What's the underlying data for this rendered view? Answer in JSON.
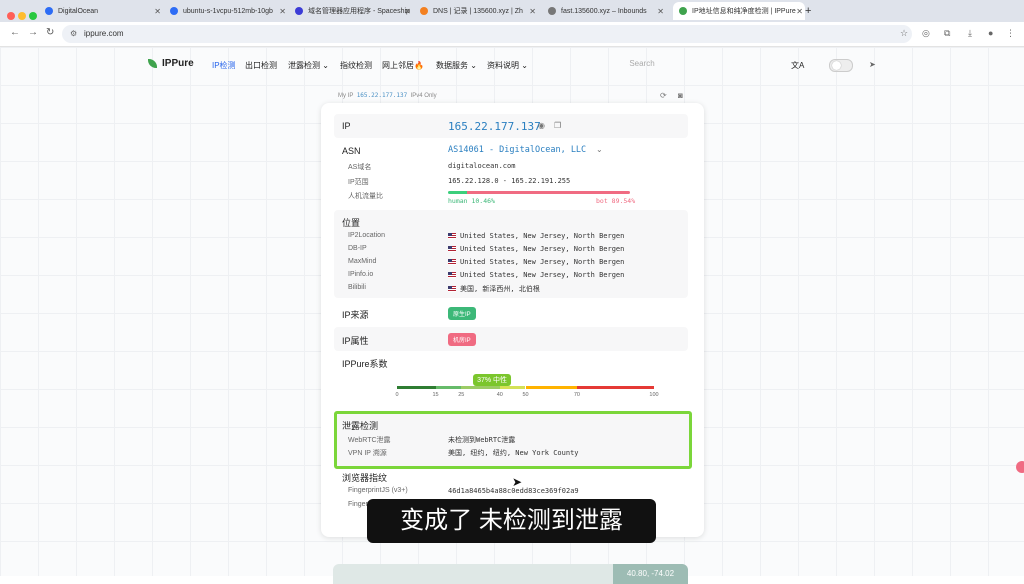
{
  "tabs": [
    {
      "title": "DigitalOcean",
      "fav": "#2d6cf5"
    },
    {
      "title": "ubuntu-s-1vcpu-512mb-10gb",
      "fav": "#2d6cf5"
    },
    {
      "title": "域名管理器应用程序 - Spaceship",
      "fav": "#3c3cd6"
    },
    {
      "title": "DNS | 记录 | 135600.xyz | Zh",
      "fav": "#f38020"
    },
    {
      "title": "fast.135600.xyz – Inbounds",
      "fav": "#777777"
    },
    {
      "title": "IP地址信息和纯净度检测 | IPPure",
      "fav": "#3fa34d"
    }
  ],
  "browser": {
    "url": "ippure.com"
  },
  "site": {
    "brand": "IPPure",
    "nav": [
      "IP检测",
      "出口检测",
      "泄露检测",
      "指纹检测",
      "网上邻居🔥",
      "数据服务",
      "资料说明"
    ],
    "search_placeholder": "Search"
  },
  "myip": {
    "label": "My IP",
    "ip": "165.22.177.137",
    "type": "IPv4 Only"
  },
  "ip_section": {
    "label": "IP",
    "value": "165.22.177.137"
  },
  "asn": {
    "label": "ASN",
    "value": "AS14061 - DigitalOcean, LLC",
    "rows": [
      {
        "label": "AS域名",
        "value": "digitalocean.com"
      },
      {
        "label": "IP范围",
        "value": "165.22.128.0 - 165.22.191.255"
      },
      {
        "label": "人机流量比",
        "value": ""
      }
    ],
    "human": "human 10.46%",
    "bot": "bot 89.54%",
    "human_fraction": 0.1046
  },
  "location": {
    "label": "位置",
    "rows": [
      {
        "label": "IP2Location",
        "value": "United States, New Jersey, North Bergen"
      },
      {
        "label": "DB-IP",
        "value": "United States, New Jersey, North Bergen"
      },
      {
        "label": "MaxMind",
        "value": "United States, New Jersey, North Bergen"
      },
      {
        "label": "IPinfo.io",
        "value": "United States, New Jersey, North Bergen"
      },
      {
        "label": "Bilibili",
        "value": "美国, 新泽西州, 北伯根"
      }
    ]
  },
  "ip_source": {
    "label": "IP来源",
    "badge": "原生IP",
    "color": "#3cb878"
  },
  "ip_attr": {
    "label": "IP属性",
    "badge": "机房IP",
    "color": "#f06b82"
  },
  "score": {
    "label": "IPPure系数",
    "badge": "37% 中性",
    "value": 37,
    "ticks": [
      "0",
      "15",
      "25",
      "40",
      "50",
      "70",
      "100"
    ]
  },
  "leak": {
    "label": "泄露检测",
    "rows": [
      {
        "label": "WebRTC泄露",
        "value": "未检测到WebRTC泄露"
      },
      {
        "label": "VPN IP 溯源",
        "value": "美国, 纽约, 纽约, New York County"
      }
    ]
  },
  "fingerprint": {
    "label": "浏览器指纹",
    "rows": [
      {
        "label": "FingerprintJS (v3+)",
        "value": "46d1a8465b4a88c0edd83ce369f02a9"
      },
      {
        "label": "Finger",
        "value": ""
      }
    ]
  },
  "map": {
    "coords": "40.80, -74.02"
  },
  "caption": "变成了 未检测到泄露"
}
